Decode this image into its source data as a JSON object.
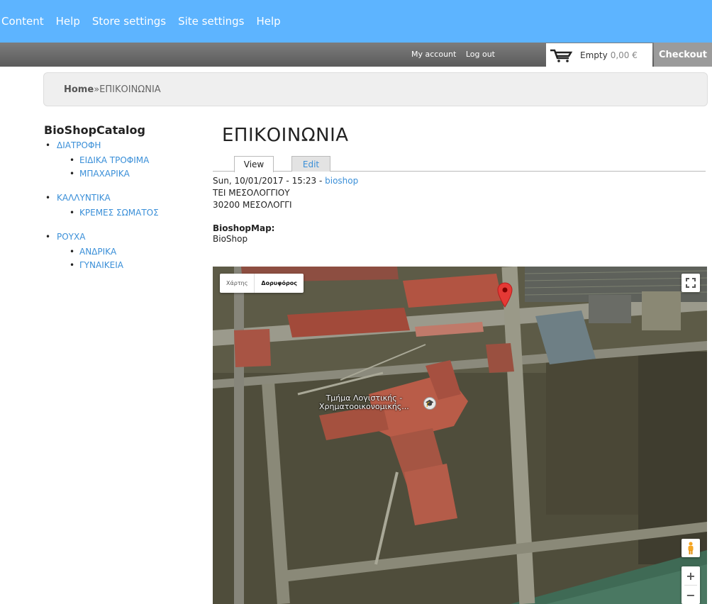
{
  "admin_menu": [
    "Content",
    "Help",
    "Store settings",
    "Site settings",
    "Help"
  ],
  "user_bar": {
    "my_account": "My account",
    "log_out": "Log out",
    "cart_status": "Empty",
    "cart_amount": "0,00 €",
    "checkout": "Checkout"
  },
  "breadcrumb": {
    "home": "Home",
    "separator": " » ",
    "current": "ΕΠΙΚΟΙΝΩΝΙΑ"
  },
  "sidebar": {
    "title": "BioShopCatalog",
    "categories": [
      {
        "label": "ΔΙΑΤΡΟΦΗ",
        "children": [
          "ΕΙΔΙΚΑ ΤΡΟΦΙΜΑ",
          "ΜΠΑΧΑΡΙΚΑ"
        ]
      },
      {
        "label": "ΚΑΛΛΥΝΤΙΚΑ",
        "children": [
          "ΚΡΕΜΕΣ ΣΩΜΑΤΟΣ"
        ]
      },
      {
        "label": "ΡΟΥΧΑ",
        "children": [
          "ΑΝΔΡΙΚΑ",
          "ΓΥΝΑΙΚΕΙΑ"
        ]
      }
    ]
  },
  "main": {
    "title": "ΕΠΙΚΟΙΝΩΝΙΑ",
    "tabs": {
      "view": "View",
      "edit": "Edit"
    },
    "submitted_date": "Sun, 10/01/2017 - 15:23 - ",
    "author": "bioshop",
    "address_line1": "ΤΕΙ ΜΕΣΟΛΟΓΓΙΟΥ",
    "address_line2": "30200 ΜΕΣΟΛΟΓΓΙ",
    "map_field_label": "BioshopMap:",
    "map_field_value": "BioShop"
  },
  "map": {
    "type_map": "Χάρτης",
    "type_satellite": "Δορυφόρος",
    "place_label_line1": "Τμήμα Λογιστικής -",
    "place_label_line2": "Χρηματοοικονομικής...",
    "zoom_in": "+",
    "zoom_out": "−",
    "pin_color": "#e53935"
  }
}
